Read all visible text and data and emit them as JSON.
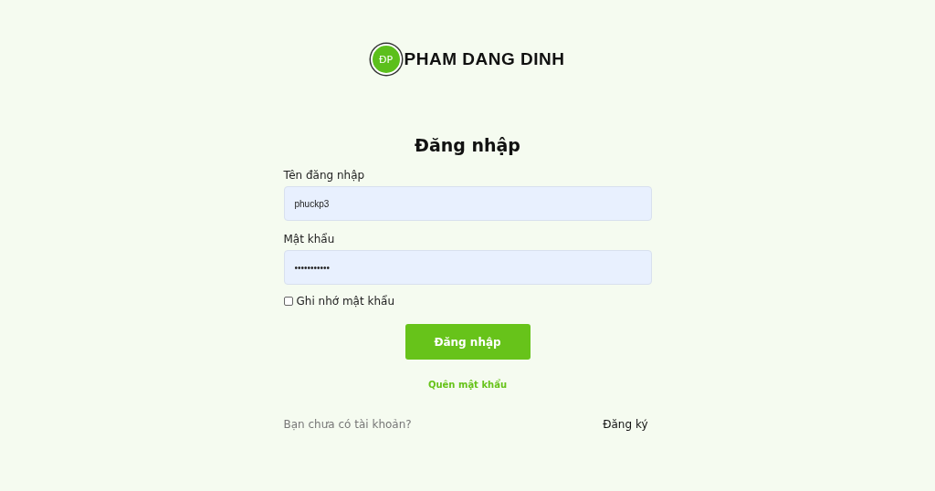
{
  "logo": {
    "initials": "ĐP",
    "name": "PHAM DANG DINH"
  },
  "title": "Đăng nhập",
  "fields": [
    {
      "label": "Tên đăng nhập",
      "value": "phuckp3"
    },
    {
      "label": "Mật khẩu",
      "value": "•••••••••••"
    }
  ],
  "remember": {
    "label": "Ghi nhớ mật khẩu",
    "checked": false
  },
  "submit": "Đăng nhập",
  "forgot": "Quên mật khẩu",
  "footer": {
    "prompt": "Bạn chưa có tài khoản?",
    "link": "Đăng ký"
  }
}
